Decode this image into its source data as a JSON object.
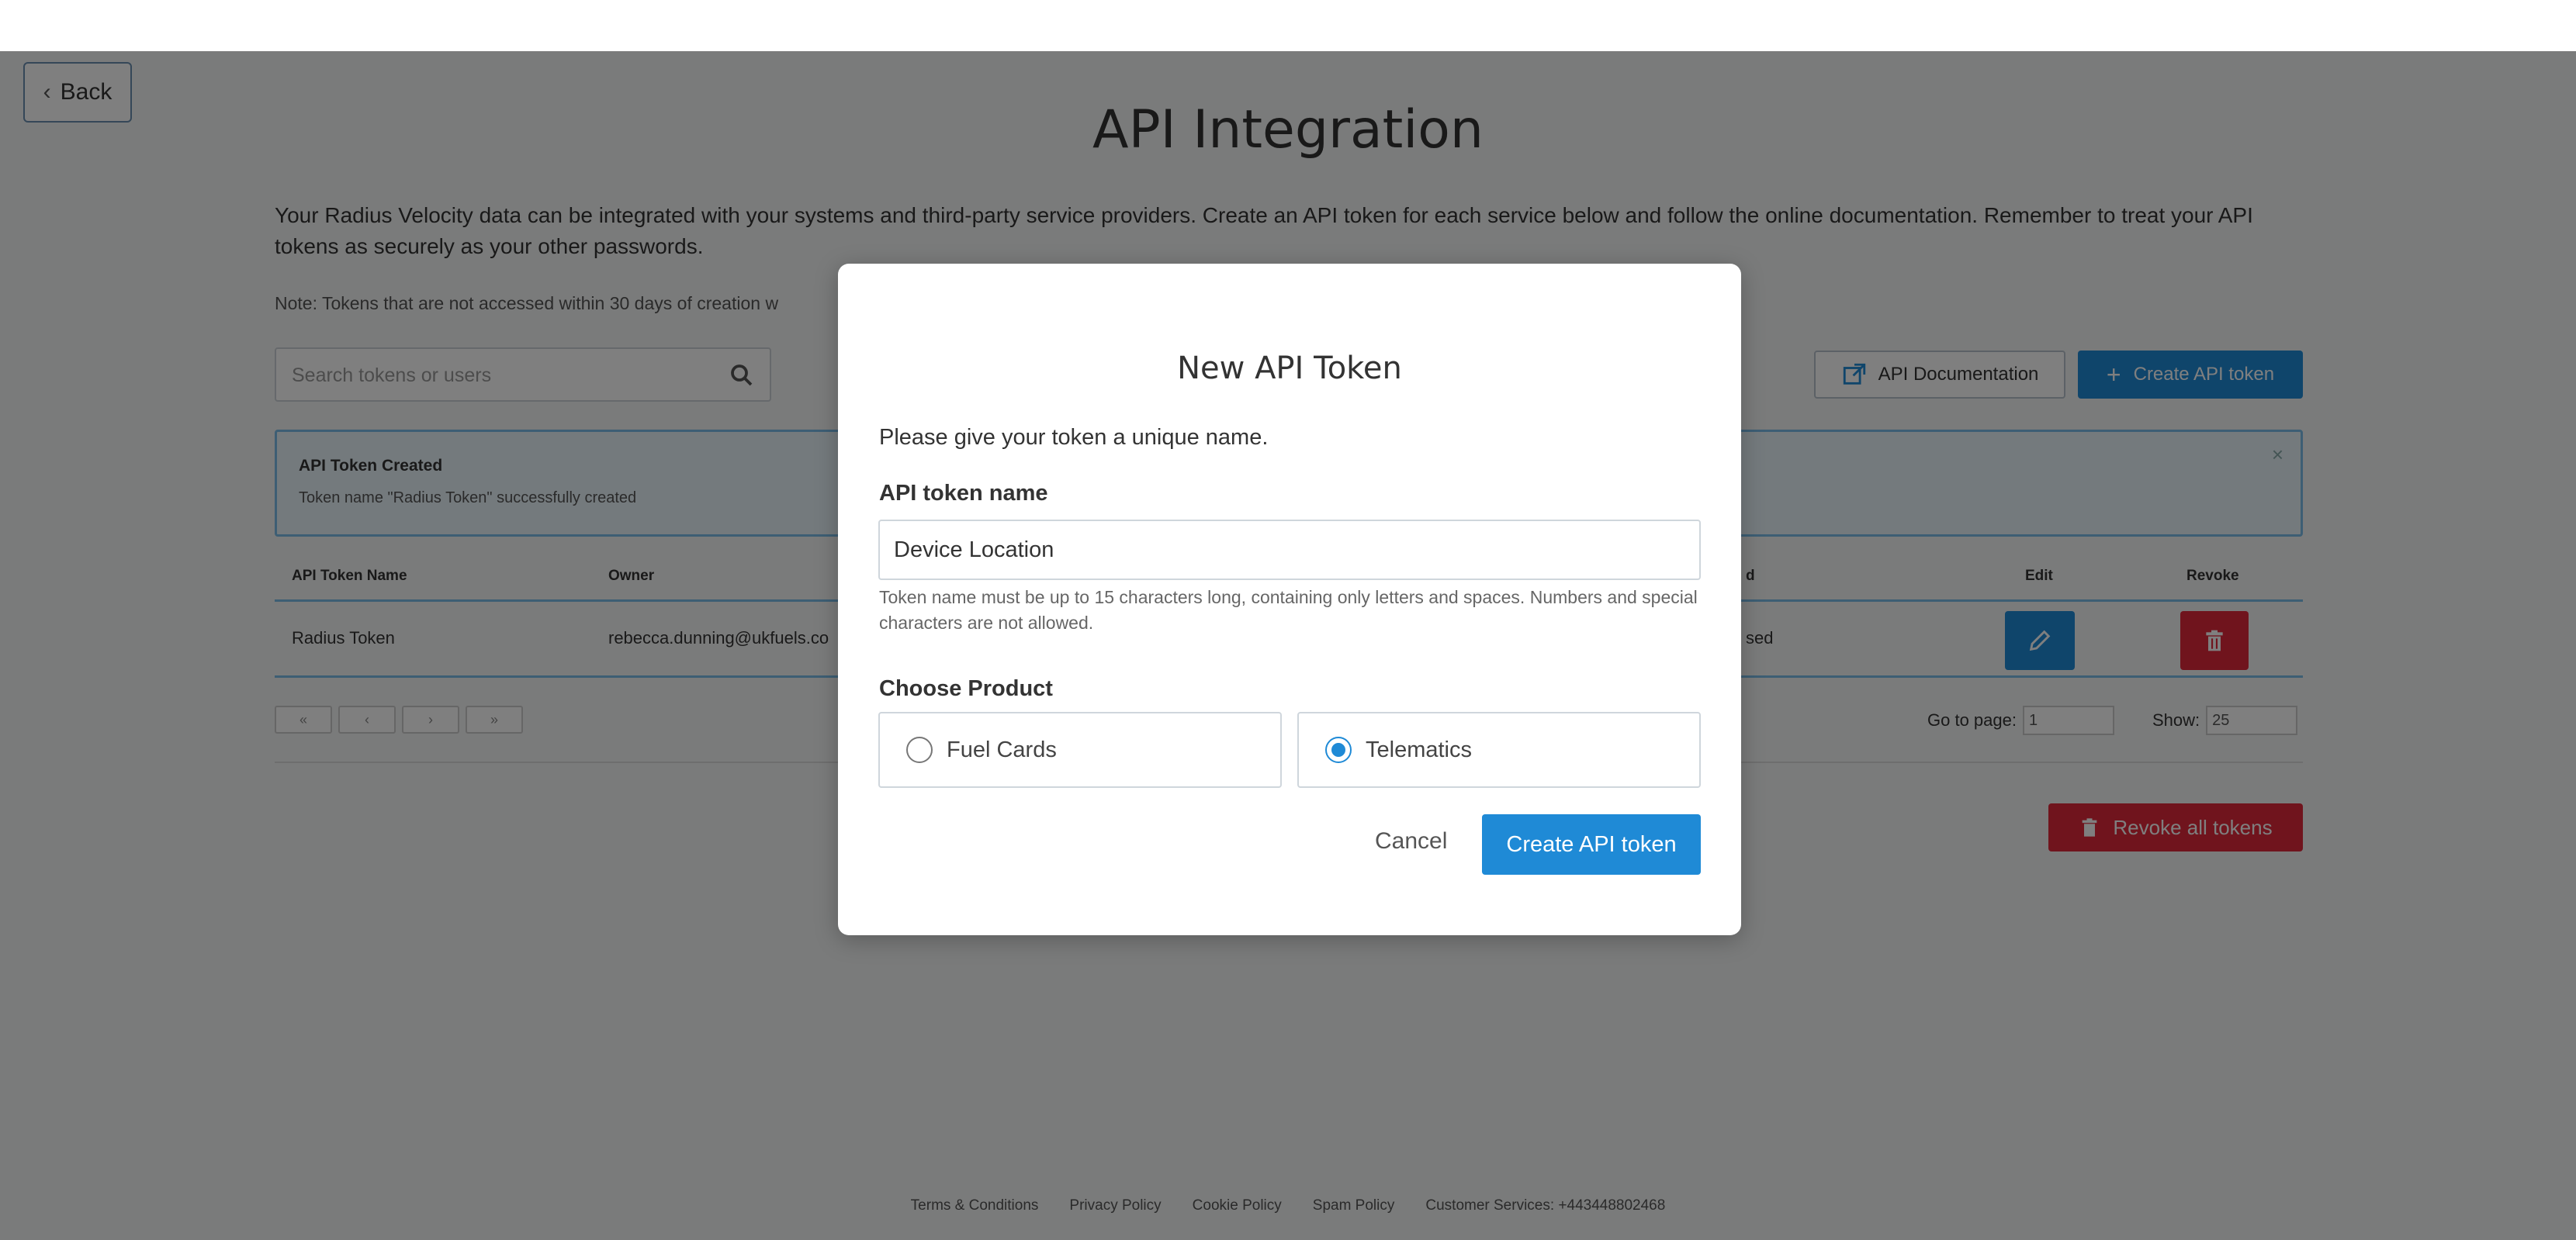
{
  "nav": {
    "back_label": "Back"
  },
  "page": {
    "title": "API Integration",
    "intro": "Your Radius Velocity data can be integrated with your systems and third-party service providers. Create an API token for each service below and follow the online documentation. Remember to treat your API tokens as securely as your other passwords.",
    "note": "Note: Tokens that are not accessed within 30 days of creation w"
  },
  "search": {
    "placeholder": "Search tokens or users",
    "icon": "search-icon"
  },
  "toolbar": {
    "documentation_label": "API Documentation",
    "create_label": "Create API token"
  },
  "alert": {
    "title": "API Token Created",
    "message": "Token name \"Radius Token\" successfully created",
    "close": "×"
  },
  "table": {
    "headers": {
      "name": "API Token Name",
      "owner": "Owner",
      "last_used": "d",
      "edit": "Edit",
      "revoke": "Revoke"
    },
    "rows": [
      {
        "name": "Radius Token",
        "owner": "rebecca.dunning@ukfuels.co",
        "last_used": "sed"
      }
    ]
  },
  "pagination": {
    "buttons": [
      "«",
      "‹",
      "›",
      "»"
    ],
    "goto_label": "Go to page:",
    "goto_value": "1",
    "show_label": "Show:",
    "show_value": "25"
  },
  "revoke_all_label": "Revoke all tokens",
  "footer": {
    "links": [
      "Terms & Conditions",
      "Privacy Policy",
      "Cookie Policy",
      "Spam Policy",
      "Customer Services: +443448802468"
    ]
  },
  "modal": {
    "title": "New API Token",
    "instruction": "Please give your token a unique name.",
    "name_label": "API token name",
    "name_value": "Device Location",
    "help_text": "Token name must be up to 15 characters long, containing only letters and spaces. Numbers and special characters are not allowed.",
    "product_label": "Choose Product",
    "products": [
      {
        "label": "Fuel Cards",
        "selected": false
      },
      {
        "label": "Telematics",
        "selected": true
      }
    ],
    "cancel_label": "Cancel",
    "create_label": "Create API token"
  },
  "colors": {
    "primary": "#1f8ad6",
    "danger": "#e0293b",
    "alert_border": "#7bbde8"
  }
}
